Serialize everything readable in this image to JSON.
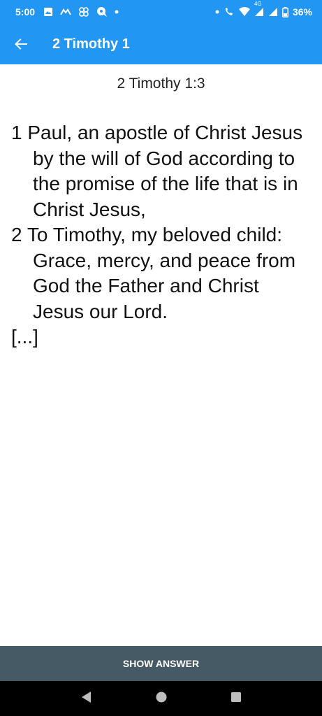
{
  "status_bar": {
    "time": "5:00",
    "network": "4G",
    "battery": "36%",
    "left_icons": [
      "image-icon",
      "messenger-icon",
      "pinwheel-icon",
      "chat-bubble-icon",
      "dot-icon"
    ],
    "right_icons": [
      "dot-icon",
      "wifi-call-icon",
      "wifi-icon",
      "signal-icon",
      "signal-icon",
      "battery-icon"
    ]
  },
  "app_bar": {
    "title": "2 Timothy 1",
    "color": "#2196f3"
  },
  "content": {
    "reference": "2 Timothy 1:3",
    "verses": [
      "1 Paul, an apostle of Christ Jesus by the will of God according to the promise of the life that is in Christ Jesus,",
      "2 To Timothy, my beloved child: Grace, mercy, and peace from God the Father and Christ Jesus our Lord."
    ],
    "blank": "[...]"
  },
  "answer_button": {
    "label": "SHOW ANSWER",
    "color": "#455a64"
  },
  "nav_bar": {
    "icons": [
      "back-triangle-icon",
      "home-circle-icon",
      "recents-square-icon"
    ]
  }
}
